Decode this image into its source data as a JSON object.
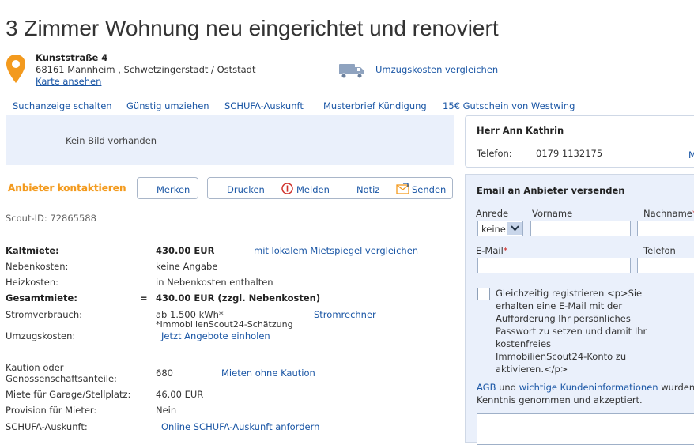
{
  "title": "3 Zimmer Wohnung neu eingerichtet und renoviert",
  "address": {
    "street": "Kunststraße 4",
    "city": "68161 Mannheim , Schwetzingerstadt / Oststadt",
    "map_link": "Karte ansehen"
  },
  "moving_link": "Umzugskosten vergleichen",
  "nav": [
    "Suchanzeige schalten",
    "Günstig umziehen",
    "SCHUFA-Auskunft",
    "Musterbrief Kündigung",
    "15€ Gutschein von Westwing"
  ],
  "image_placeholder": "Kein Bild vorhanden",
  "actions": {
    "contact": "Anbieter kontaktieren",
    "remember": "Merken",
    "print": "Drucken",
    "report": "Melden",
    "note": "Notiz",
    "send": "Senden"
  },
  "scout_id": "Scout-ID: 72865588",
  "costs": {
    "kaltmiete_label": "Kaltmiete:",
    "kaltmiete_value": "430.00 EUR",
    "kaltmiete_link": "mit lokalem Mietspiegel vergleichen",
    "nebenkosten_label": "Nebenkosten:",
    "nebenkosten_value": "keine Angabe",
    "heizkosten_label": "Heizkosten:",
    "heizkosten_value": "in Nebenkosten enthalten",
    "gesamt_label": "Gesamtmiete:",
    "gesamt_eq": "=",
    "gesamt_value": "430.00 EUR (zzgl. Nebenkosten)",
    "strom_label": "Stromverbrauch:",
    "strom_value": "ab 1.500 kWh*",
    "strom_note": "*ImmobilienScout24-Schätzung",
    "strom_link": "Stromrechner",
    "umzug_label": "Umzugskosten:",
    "umzug_link": "Jetzt Angebote einholen",
    "kaution_label_1": "Kaution oder",
    "kaution_label_2": "Genossenschaftsanteile:",
    "kaution_value": "680",
    "kaution_link": "Mieten ohne Kaution",
    "garage_label": "Miete für Garage/Stellplatz:",
    "garage_value": "46.00 EUR",
    "provision_label": "Provision für Mieter:",
    "provision_value": "Nein",
    "schufa_label": "SCHUFA-Auskunft:",
    "schufa_link": "Online SCHUFA-Auskunft anfordern"
  },
  "contact": {
    "name": "Herr Ann Kathrin",
    "phone_label": "Telefon:",
    "phone_value": "0179 1132175",
    "more": "M"
  },
  "form": {
    "title": "Email an Anbieter versenden",
    "anrede_label": "Anrede",
    "anrede_value": "keine",
    "vorname_label": "Vorname",
    "nachname_label": "Nachname",
    "nachname_star": "*",
    "email_label": "E-Mail",
    "email_star": "*",
    "telefon_label": "Telefon",
    "register_lines": [
      "Gleichzeitig registrieren   <p>Sie",
      "erhalten eine E-Mail mit der",
      "Aufforderung Ihr persönliches",
      "Passwort zu setzen und damit Ihr",
      "kostenfreies",
      "ImmobilienScout24-Konto zu",
      "aktivieren.</p>"
    ],
    "agb_link": "AGB",
    "agb_and": "und",
    "info_link": "wichtige Kundeninformationen",
    "agb_rest_1": "wurden",
    "agb_rest_2": "Kenntnis genommen und akzeptiert."
  },
  "colors": {
    "accent_orange": "#f39a1e",
    "link_blue": "#1a56a5",
    "panel_bg": "#eaf0fb"
  }
}
